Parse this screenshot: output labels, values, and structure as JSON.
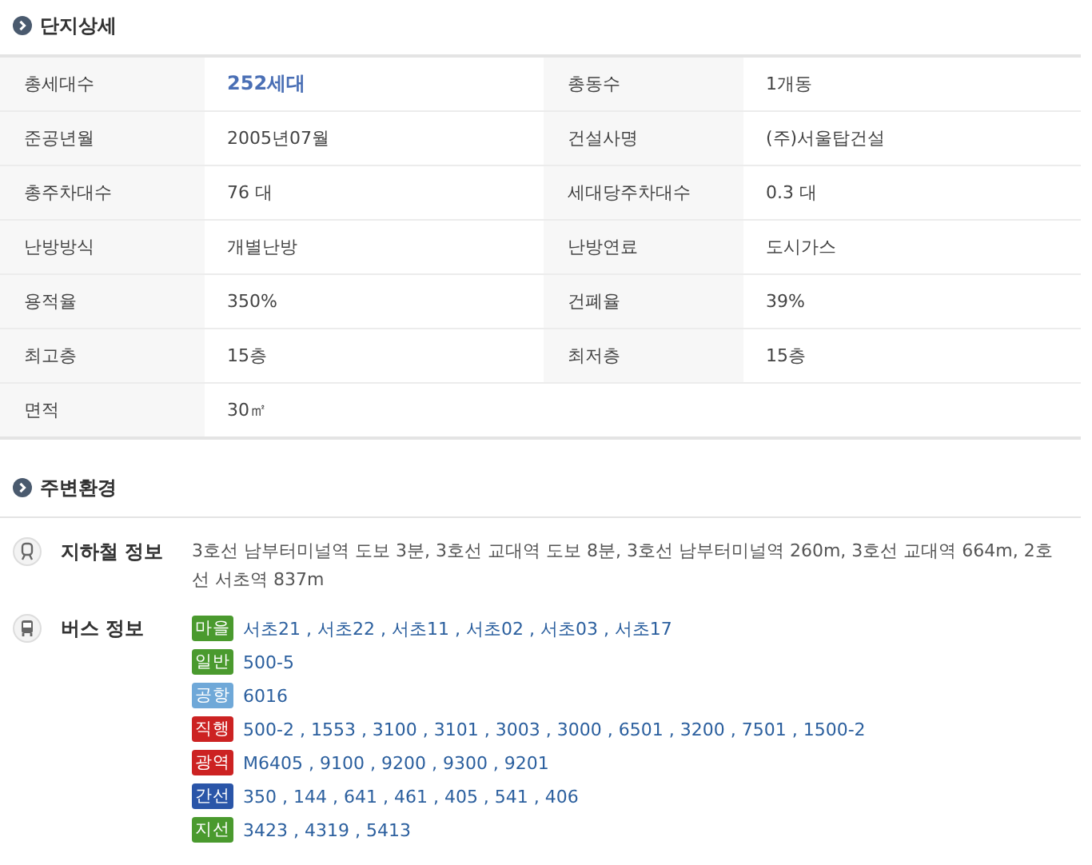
{
  "detail": {
    "title": "단지상세",
    "rows": [
      [
        {
          "label": "총세대수",
          "value": "252세대",
          "highlight": true
        },
        {
          "label": "총동수",
          "value": "1개동",
          "highlight": false
        }
      ],
      [
        {
          "label": "준공년월",
          "value": "2005년07월",
          "highlight": false
        },
        {
          "label": "건설사명",
          "value": "(주)서울탑건설",
          "highlight": false
        }
      ],
      [
        {
          "label": "총주차대수",
          "value": "76 대",
          "highlight": false
        },
        {
          "label": "세대당주차대수",
          "value": "0.3 대",
          "highlight": false
        }
      ],
      [
        {
          "label": "난방방식",
          "value": "개별난방",
          "highlight": false
        },
        {
          "label": "난방연료",
          "value": "도시가스",
          "highlight": false
        }
      ],
      [
        {
          "label": "용적율",
          "value": "350%",
          "highlight": false
        },
        {
          "label": "건폐율",
          "value": "39%",
          "highlight": false
        }
      ],
      [
        {
          "label": "최고층",
          "value": "15층",
          "highlight": false
        },
        {
          "label": "최저층",
          "value": "15층",
          "highlight": false
        }
      ],
      [
        {
          "label": "면적",
          "value": "30㎡",
          "highlight": false
        }
      ]
    ]
  },
  "surroundings": {
    "title": "주변환경",
    "subway": {
      "label": "지하철 정보",
      "text": "3호선 남부터미널역 도보 3분, 3호선 교대역 도보 8분, 3호선 남부터미널역 260m, 3호선 교대역 664m, 2호선 서초역 837m"
    },
    "bus": {
      "label": "버스 정보",
      "lines": [
        {
          "type": "마을",
          "color": "#4a9a2e",
          "routes": "서초21 , 서초22 , 서초11 , 서초02 , 서초03 , 서초17"
        },
        {
          "type": "일반",
          "color": "#4a9a2e",
          "routes": "500-5"
        },
        {
          "type": "공항",
          "color": "#6fa8d8",
          "routes": "6016"
        },
        {
          "type": "직행",
          "color": "#cc2222",
          "routes": "500-2 , 1553 , 3100 , 3101 , 3003 , 3000 , 6501 , 3200 , 7501 , 1500-2"
        },
        {
          "type": "광역",
          "color": "#cc2222",
          "routes": "M6405 , 9100 , 9200 , 9300 , 9201"
        },
        {
          "type": "간선",
          "color": "#2a55a8",
          "routes": "350 , 144 , 641 , 461 , 405 , 541 , 406"
        },
        {
          "type": "지선",
          "color": "#4a9a2e",
          "routes": "3423 , 4319 , 5413"
        }
      ]
    }
  }
}
